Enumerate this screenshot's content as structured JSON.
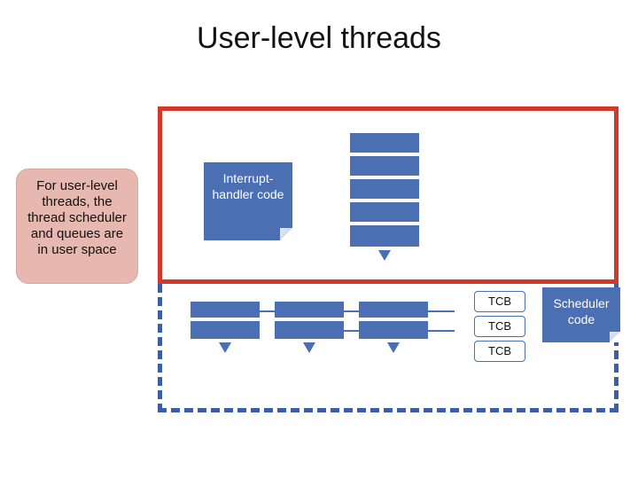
{
  "title": "User-level threads",
  "note": "For user-level threads, the thread scheduler and queues are in user space",
  "interrupt_handler": "Interrupt-handler code",
  "scheduler": "Scheduler code",
  "tcb_labels": [
    "TCB",
    "TCB",
    "TCB"
  ],
  "chart_data": {
    "type": "diagram",
    "title": "User-level threads",
    "annotations": [
      "For user-level threads, the thread scheduler and queues are in user space"
    ],
    "regions": [
      {
        "name": "kernel",
        "border": "solid-red",
        "contains": [
          "interrupt-handler-code",
          "kernel-stack"
        ]
      },
      {
        "name": "user-space",
        "border": "dashed-blue",
        "contains": [
          "thread-stacks",
          "tcb-queue",
          "scheduler-code"
        ]
      }
    ],
    "components": {
      "interrupt_handler": "Interrupt-handler code",
      "scheduler": "Scheduler code",
      "tcb_queue_length": 3,
      "user_thread_stacks": 3,
      "kernel_stack_segments": 5
    }
  }
}
